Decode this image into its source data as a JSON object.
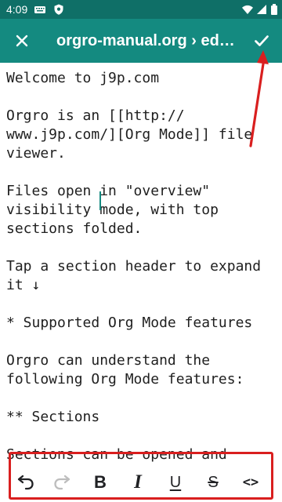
{
  "status_bar": {
    "time": "4:09",
    "icons": [
      "keyboard-icon",
      "shield-icon",
      "wifi-icon",
      "cellular-icon",
      "battery-icon"
    ]
  },
  "app_bar": {
    "title": "orgro-manual.org › edit…",
    "close_icon": "close-icon",
    "done_icon": "check-icon"
  },
  "editor": {
    "content": "Welcome to j9p.com\n\nOrgro is an [[http://\nwww.j9p.com/][Org Mode]] file\nviewer.\n\nFiles open in \"overview\"\nvisibility mode, with top\nsections folded.\n\nTap a section header to expand\nit ↓\n\n* Supported Org Mode features\n\nOrgro can understand the\nfollowing Org Mode features:\n\n** Sections\n\nSections can be opened and"
  },
  "toolbar": {
    "buttons": [
      {
        "name": "undo",
        "label": "Undo",
        "icon": "undo-icon",
        "enabled": true
      },
      {
        "name": "redo",
        "label": "Redo",
        "icon": "redo-icon",
        "enabled": false
      },
      {
        "name": "bold",
        "label": "B",
        "icon": "bold-icon",
        "enabled": true
      },
      {
        "name": "italic",
        "label": "I",
        "icon": "italic-icon",
        "enabled": true
      },
      {
        "name": "underline",
        "label": "U",
        "icon": "underline-icon",
        "enabled": true
      },
      {
        "name": "strikethrough",
        "label": "S",
        "icon": "strikethrough-icon",
        "enabled": true
      },
      {
        "name": "code",
        "label": "<>",
        "icon": "code-icon",
        "enabled": true
      }
    ]
  },
  "colors": {
    "status_bar": "#0f6f67",
    "app_bar": "#148a80",
    "annotation": "#d91f1f",
    "cursor": "#148a80"
  }
}
